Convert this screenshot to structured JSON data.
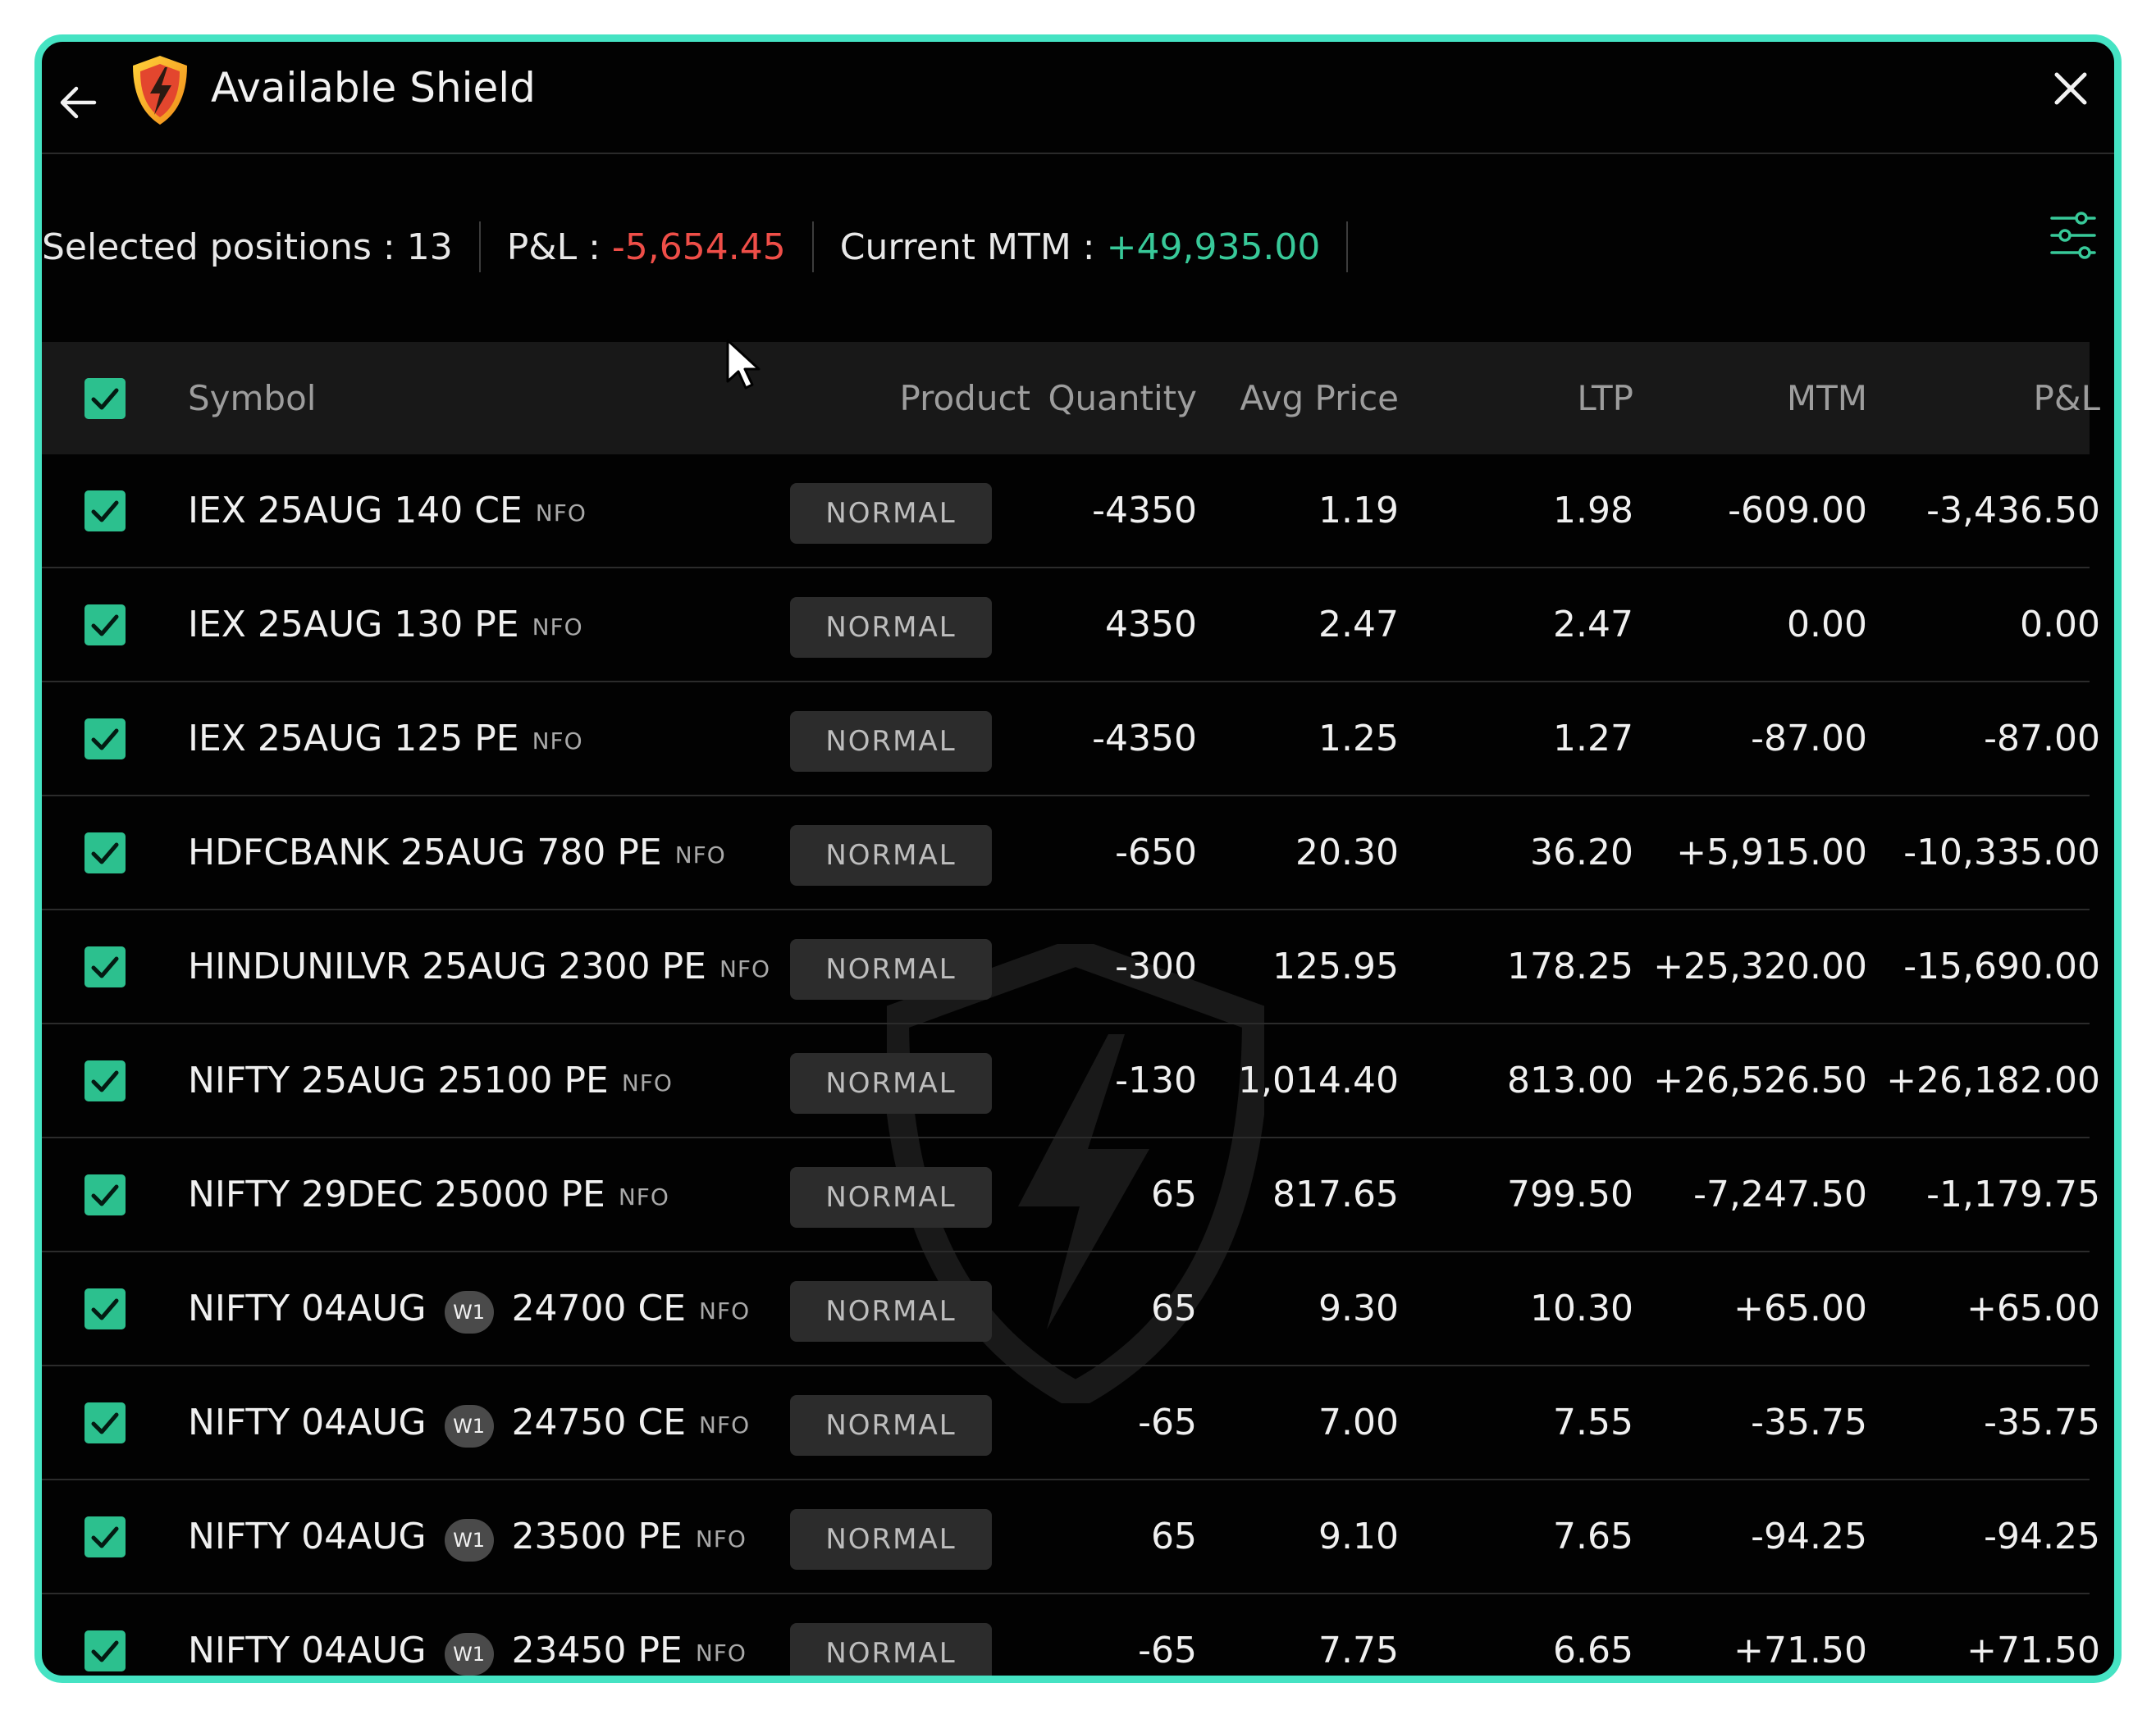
{
  "header": {
    "title": "Available Shield"
  },
  "summary": {
    "selected_label": "Selected positions :",
    "selected_value": "13",
    "pl_label": "P&L :",
    "pl_value": "-5,654.45",
    "mtm_label": "Current MTM :",
    "mtm_value": "+49,935.00"
  },
  "table": {
    "columns": [
      "Symbol",
      "Product",
      "Quantity",
      "Avg Price",
      "LTP",
      "MTM",
      "P&L"
    ],
    "rows": [
      {
        "symbol": "IEX 25AUG 140 CE",
        "week": "",
        "symbol_tail": "",
        "exchange": "NFO",
        "product": "NORMAL",
        "quantity": "-4350",
        "avg_price": "1.19",
        "ltp": "1.98",
        "mtm": "-609.00",
        "pl": "-3,436.50"
      },
      {
        "symbol": "IEX 25AUG 130 PE",
        "week": "",
        "symbol_tail": "",
        "exchange": "NFO",
        "product": "NORMAL",
        "quantity": "4350",
        "avg_price": "2.47",
        "ltp": "2.47",
        "mtm": "0.00",
        "pl": "0.00"
      },
      {
        "symbol": "IEX 25AUG 125 PE",
        "week": "",
        "symbol_tail": "",
        "exchange": "NFO",
        "product": "NORMAL",
        "quantity": "-4350",
        "avg_price": "1.25",
        "ltp": "1.27",
        "mtm": "-87.00",
        "pl": "-87.00"
      },
      {
        "symbol": "HDFCBANK 25AUG 780 PE",
        "week": "",
        "symbol_tail": "",
        "exchange": "NFO",
        "product": "NORMAL",
        "quantity": "-650",
        "avg_price": "20.30",
        "ltp": "36.20",
        "mtm": "+5,915.00",
        "pl": "-10,335.00"
      },
      {
        "symbol": "HINDUNILVR 25AUG 2300 PE",
        "week": "",
        "symbol_tail": "",
        "exchange": "NFO",
        "product": "NORMAL",
        "quantity": "-300",
        "avg_price": "125.95",
        "ltp": "178.25",
        "mtm": "+25,320.00",
        "pl": "-15,690.00"
      },
      {
        "symbol": "NIFTY 25AUG 25100 PE",
        "week": "",
        "symbol_tail": "",
        "exchange": "NFO",
        "product": "NORMAL",
        "quantity": "-130",
        "avg_price": "1,014.40",
        "ltp": "813.00",
        "mtm": "+26,526.50",
        "pl": "+26,182.00"
      },
      {
        "symbol": "NIFTY 29DEC 25000 PE",
        "week": "",
        "symbol_tail": "",
        "exchange": "NFO",
        "product": "NORMAL",
        "quantity": "65",
        "avg_price": "817.65",
        "ltp": "799.50",
        "mtm": "-7,247.50",
        "pl": "-1,179.75"
      },
      {
        "symbol": "NIFTY 04AUG",
        "week": "W1",
        "symbol_tail": "24700 CE",
        "exchange": "NFO",
        "product": "NORMAL",
        "quantity": "65",
        "avg_price": "9.30",
        "ltp": "10.30",
        "mtm": "+65.00",
        "pl": "+65.00"
      },
      {
        "symbol": "NIFTY 04AUG",
        "week": "W1",
        "symbol_tail": "24750 CE",
        "exchange": "NFO",
        "product": "NORMAL",
        "quantity": "-65",
        "avg_price": "7.00",
        "ltp": "7.55",
        "mtm": "-35.75",
        "pl": "-35.75"
      },
      {
        "symbol": "NIFTY 04AUG",
        "week": "W1",
        "symbol_tail": "23500 PE",
        "exchange": "NFO",
        "product": "NORMAL",
        "quantity": "65",
        "avg_price": "9.10",
        "ltp": "7.65",
        "mtm": "-94.25",
        "pl": "-94.25"
      },
      {
        "symbol": "NIFTY 04AUG",
        "week": "W1",
        "symbol_tail": "23450 PE",
        "exchange": "NFO",
        "product": "NORMAL",
        "quantity": "-65",
        "avg_price": "7.75",
        "ltp": "6.65",
        "mtm": "+71.50",
        "pl": "+71.50"
      }
    ]
  },
  "colors": {
    "positive": "#38c999",
    "negative": "#ef4e48",
    "neutral": "#f0f0f0",
    "accent_border": "#45e3c3",
    "checkbox": "#2cc08e"
  },
  "icons": {
    "back": "arrow-left-icon",
    "logo": "shield-lightning-icon",
    "close": "close-icon",
    "filter": "sliders-icon",
    "checkbox": "checkbox-checked-icon"
  }
}
